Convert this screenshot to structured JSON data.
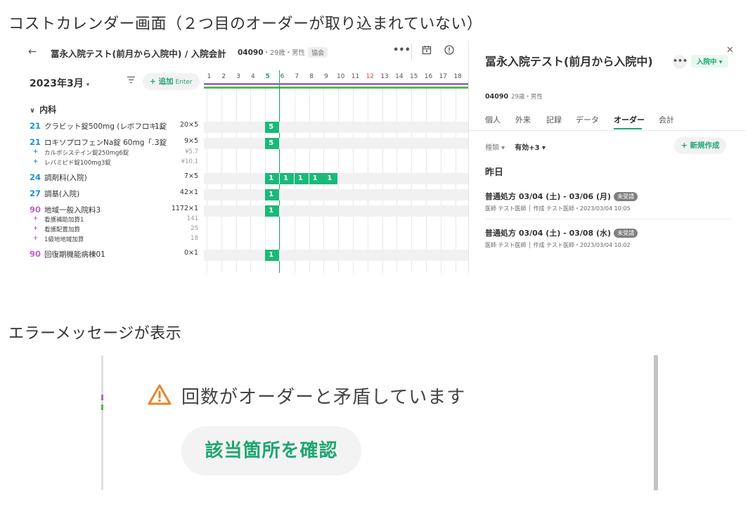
{
  "captions": {
    "top": "コストカレンダー画面（２つ目のオーダーが取り込まれていない）",
    "middle": "エラーメッセージが表示"
  },
  "header": {
    "title": "冨永入院テスト(前月から入院中) / 入院会計",
    "patient_id": "04090",
    "patient_meta": "・29歳・男性",
    "insurance_badge": "協会",
    "icons": [
      "back-arrow-icon",
      "more-icon",
      "calendar-icon",
      "info-icon"
    ]
  },
  "toolbar": {
    "month": "2023年3月",
    "month_caret": "▾",
    "add_label": "+ 追加",
    "add_shortcut": "Enter"
  },
  "calendar": {
    "days": [
      "1",
      "2",
      "3",
      "4",
      "5",
      "6",
      "7",
      "8",
      "9",
      "10",
      "11",
      "12",
      "13",
      "14",
      "15",
      "16",
      "17",
      "18"
    ],
    "today_day": "5",
    "red_days": [
      "12"
    ]
  },
  "section": {
    "label": "内科",
    "chevron": "∨"
  },
  "rows": [
    {
      "num": "21",
      "num_color": "#1a8fd8",
      "name": "クラビット錠500mg (レボフロキ...",
      "qty": "1錠",
      "mult": "20×5",
      "cells": [
        {
          "col": 4,
          "v": "5"
        }
      ]
    },
    {
      "num": "21",
      "num_color": "#1a8fd8",
      "name": "ロキソプロフェンNa錠 60mg「...",
      "qty": "3錠",
      "mult": "9×5",
      "cells": [
        {
          "col": 4,
          "v": "5"
        }
      ]
    },
    {
      "sub": true,
      "plus_color": "#1a8fd8",
      "name": "カルボシステイン錠250mg6錠",
      "mult": "¥5.7"
    },
    {
      "sub": true,
      "plus_color": "#1a8fd8",
      "name": "レバミピド錠100mg3錠",
      "mult": "¥10.1"
    },
    {
      "num": "24",
      "num_color": "#1a8fd8",
      "name": "調剤料(入院)",
      "qty": "",
      "mult": "7×5",
      "cells": [
        {
          "col": 4,
          "v": "1"
        },
        {
          "col": 5,
          "v": "1"
        },
        {
          "col": 6,
          "v": "1"
        },
        {
          "col": 7,
          "v": "1"
        },
        {
          "col": 8,
          "v": "1"
        }
      ]
    },
    {
      "num": "27",
      "num_color": "#1a8fd8",
      "name": "調基(入院)",
      "qty": "",
      "mult": "42×1",
      "cells": [
        {
          "col": 4,
          "v": "1"
        }
      ]
    },
    {
      "num": "90",
      "num_color": "#c060c8",
      "name": "地域一般入院料3",
      "qty": "",
      "mult": "1172×1",
      "cells": [
        {
          "col": 4,
          "v": "1"
        }
      ]
    },
    {
      "sub": true,
      "plus_color": "#c060c8",
      "name": "看護補助加算1",
      "mult": "141"
    },
    {
      "sub": true,
      "plus_color": "#c060c8",
      "name": "看護配置加算",
      "mult": "25"
    },
    {
      "sub": true,
      "plus_color": "#c060c8",
      "name": "1級地地域加算",
      "mult": "18"
    },
    {
      "num": "90",
      "num_color": "#c060c8",
      "name": "回復期機能病棟01",
      "qty": "",
      "mult": "0×1",
      "cells": [
        {
          "col": 4,
          "v": "1"
        }
      ]
    }
  ],
  "panel": {
    "title": "冨永入院テスト(前月から入院中)",
    "more": "•••",
    "status": "入院中 ▾",
    "close": "✕",
    "patient_id": "04090",
    "patient_meta": "29歳・男性",
    "tabs": [
      "個人",
      "外来",
      "記録",
      "データ",
      "オーダー",
      "会計"
    ],
    "active_tab": "オーダー",
    "filter_label": "種類 ▾",
    "filter_value": "有効+3 ▾",
    "new_button": "+ 新規作成",
    "group": "昨日",
    "orders": [
      {
        "title": "普通処方  03/04 (土) - 03/06 (月)",
        "status": "未受請",
        "meta": "医師 テスト医師 │ 作成 テスト医師・2023/03/04 10:05"
      },
      {
        "title": "普通処方  03/04 (土) - 03/08 (水)",
        "status": "未受請",
        "meta": "医師 テスト医師 │ 作成 テスト医師・2023/03/04 10:02"
      }
    ]
  },
  "error": {
    "icon": "warning-icon",
    "message": "回数がオーダーと矛盾しています",
    "button": "該当箇所を確認",
    "accent": "#1ea672",
    "warning_color": "#e8852a"
  }
}
